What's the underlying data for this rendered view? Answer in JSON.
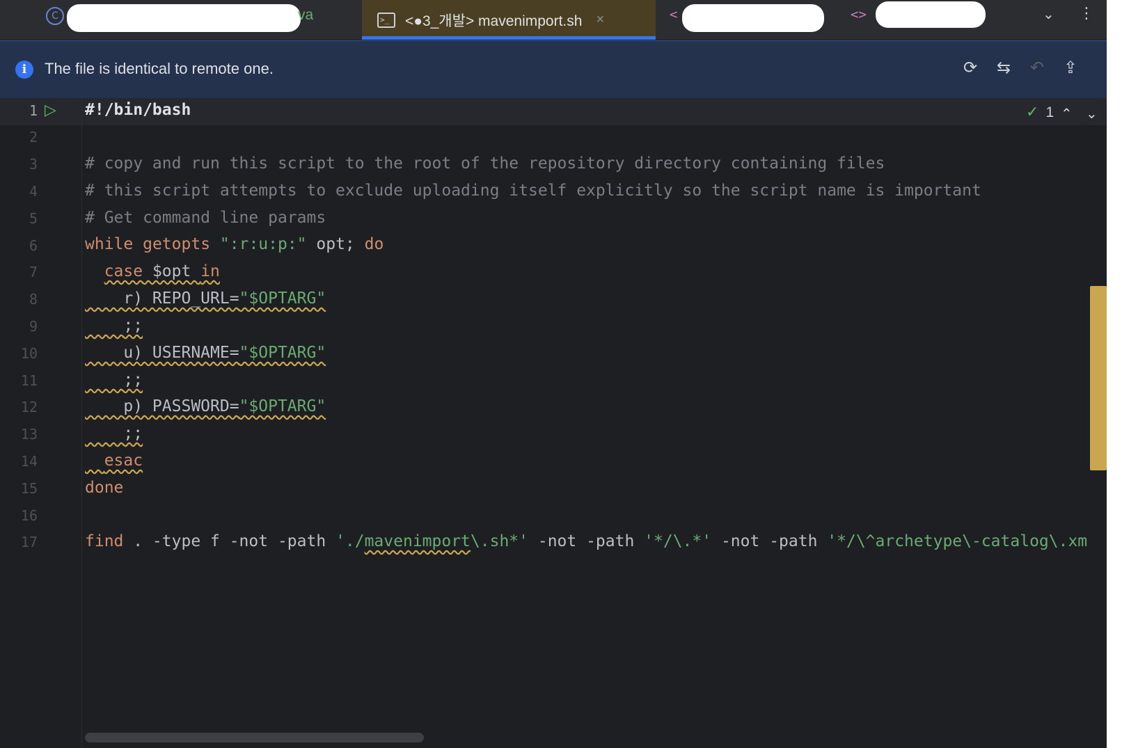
{
  "tabs": [
    {
      "label": "",
      "kind": "java",
      "visible_suffix": "va"
    },
    {
      "label": "<●3_개발> mavenimport.sh",
      "kind": "shell",
      "active": true,
      "close": "×"
    },
    {
      "label": "",
      "kind": "html",
      "prefix": "<"
    },
    {
      "label": "",
      "kind": "html",
      "prefix": "<>"
    }
  ],
  "tabbar": {
    "more_tabs_icon": "chevron-down-icon",
    "menu_icon": "kebab-icon"
  },
  "banner": {
    "message": "The file is identical to remote one.",
    "icon": "info-icon",
    "actions": [
      "sync-icon",
      "compare-icon",
      "revert-icon",
      "upload-icon"
    ]
  },
  "editor": {
    "inspection": {
      "count": "1"
    },
    "colors": {
      "keyword": "#cf8e6d",
      "string": "#6aab73",
      "comment": "#7a7e85",
      "warning": "#c9a64f"
    },
    "lines": [
      {
        "n": "1"
      },
      {
        "n": "2"
      },
      {
        "n": "3"
      },
      {
        "n": "4"
      },
      {
        "n": "5"
      },
      {
        "n": "6"
      },
      {
        "n": "7"
      },
      {
        "n": "8"
      },
      {
        "n": "9"
      },
      {
        "n": "10"
      },
      {
        "n": "11"
      },
      {
        "n": "12"
      },
      {
        "n": "13"
      },
      {
        "n": "14"
      },
      {
        "n": "15"
      },
      {
        "n": "16"
      },
      {
        "n": "17"
      }
    ],
    "code": {
      "l1": "#!/bin/bash",
      "l3": "# copy and run this script to the root of the repository directory containing files",
      "l4": "# this script attempts to exclude uploading itself explicitly so the script name is important",
      "l5": "# Get command line params",
      "l6_kw1": "while",
      "l6_fn": "getopts",
      "l6_str": "\":r:u:p:\"",
      "l6_rest": " opt; ",
      "l6_kw2": "do",
      "l7_kw1": "case",
      "l7_var": " $opt ",
      "l7_kw2": "in",
      "l8_pre": "r) REPO_URL=",
      "l8_str": "\"$OPTARG\"",
      "l9": ";;",
      "l10_pre": "u) USERNAME=",
      "l10_str": "\"$OPTARG\"",
      "l11": ";;",
      "l12_pre": "p) PASSWORD=",
      "l12_str": "\"$OPTARG\"",
      "l13": ";;",
      "l14": "esac",
      "l15": "done",
      "l17_kw": "find",
      "l17_a": " . -type f -not -path ",
      "l17_s1a": "'./",
      "l17_s1b": "mavenimport",
      "l17_s1c": "\\.sh*'",
      "l17_b": " -not -path ",
      "l17_s2": "'*/\\.*'",
      "l17_c": " -not -path ",
      "l17_s3": "'*/\\^archetype\\-catalog\\.xm"
    }
  }
}
